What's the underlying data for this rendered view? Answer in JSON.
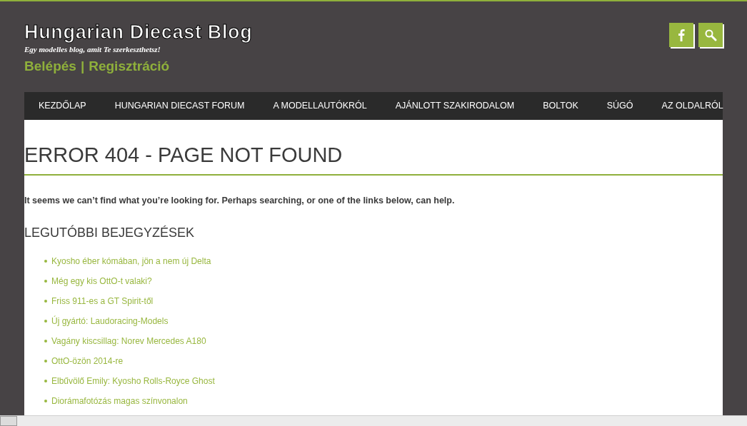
{
  "header": {
    "site_title": "Hungarian Diecast Blog",
    "tagline": "Egy modelles blog, amit Te szerkeszthetsz!",
    "login": "Belépés",
    "separator": "|",
    "register": "Regisztráció"
  },
  "nav": {
    "items": [
      {
        "label": "KEZDŐLAP"
      },
      {
        "label": "HUNGARIAN DIECAST FORUM"
      },
      {
        "label": "A MODELLAUTÓKRÓL"
      },
      {
        "label": "AJÁNLOTT SZAKIRODALOM"
      },
      {
        "label": "BOLTOK"
      },
      {
        "label": "SÚGÓ"
      },
      {
        "label": "AZ OLDALRÓL"
      }
    ]
  },
  "content": {
    "title": "ERROR 404 - PAGE NOT FOUND",
    "message": "It seems we can’t find what you’re looking for. Perhaps searching, or one of the links below, can help.",
    "section_title": "LEGUTÓBBI BEJEGYZÉSEK",
    "posts": [
      "Kyosho éber kómában, jön a nem új Delta",
      "Még egy kis OttO-t valaki?",
      "Friss 911-es a GT Spirit-től",
      "Új gyártó: Laudoracing-Models",
      "Vagány kiscsillag: Norev Mercedes A180",
      "OttO-özön 2014-re",
      "Elbűvölő Emily: Kyosho Rolls-Royce Ghost",
      "Diorámafotózás magas színvonalon"
    ]
  }
}
